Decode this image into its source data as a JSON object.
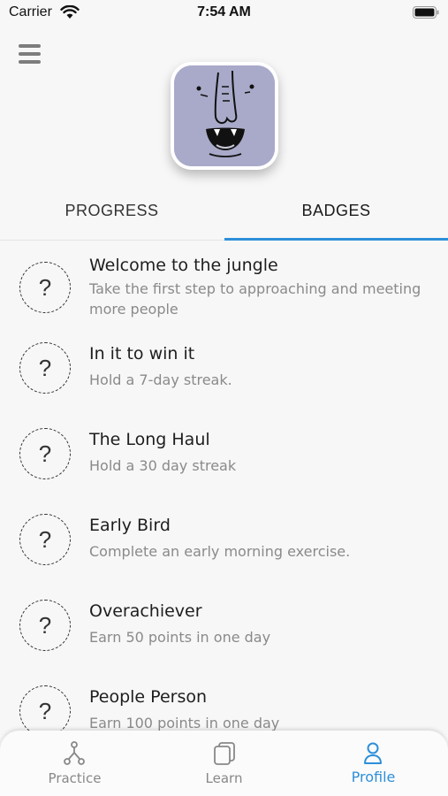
{
  "status_bar": {
    "carrier": "Carrier",
    "time": "7:54 AM"
  },
  "tabs": [
    {
      "label": "PROGRESS",
      "active": false
    },
    {
      "label": "BADGES",
      "active": true
    }
  ],
  "badges": [
    {
      "icon": "?",
      "title": "Welcome to the jungle",
      "description": "Take the first step to approaching and meeting more people"
    },
    {
      "icon": "?",
      "title": "In it to win it",
      "description": "Hold a 7-day streak."
    },
    {
      "icon": "?",
      "title": "The Long Haul",
      "description": "Hold a 30 day streak"
    },
    {
      "icon": "?",
      "title": "Early Bird",
      "description": "Complete an early morning exercise."
    },
    {
      "icon": "?",
      "title": "Overachiever",
      "description": "Earn 50 points in one day"
    },
    {
      "icon": "?",
      "title": "People Person",
      "description": "Earn 100 points in one day"
    }
  ],
  "bottom_nav": {
    "items": [
      {
        "label": "Practice",
        "icon": "branch-icon"
      },
      {
        "label": "Learn",
        "icon": "cards-icon"
      },
      {
        "label": "Profile",
        "icon": "person-icon",
        "active": true
      }
    ]
  },
  "colors": {
    "accent": "#2e8fd9",
    "avatar_bg": "#a9aac9",
    "page_bg": "#f7f7f7"
  }
}
